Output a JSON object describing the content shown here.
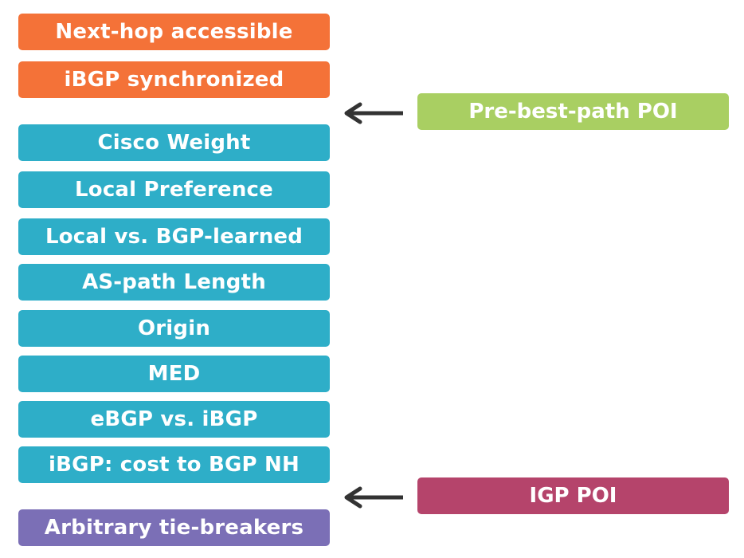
{
  "steps": [
    {
      "label": "Next-hop accessible",
      "category": "pre-check",
      "color": "#f47238"
    },
    {
      "label": "iBGP synchronized",
      "category": "pre-check",
      "color": "#f47238"
    },
    {
      "label": "Cisco Weight",
      "category": "best-path",
      "color": "#2eaec8"
    },
    {
      "label": "Local Preference",
      "category": "best-path",
      "color": "#2eaec8"
    },
    {
      "label": "Local vs. BGP-learned",
      "category": "best-path",
      "color": "#2eaec8"
    },
    {
      "label": "AS-path Length",
      "category": "best-path",
      "color": "#2eaec8"
    },
    {
      "label": "Origin",
      "category": "best-path",
      "color": "#2eaec8"
    },
    {
      "label": "MED",
      "category": "best-path",
      "color": "#2eaec8"
    },
    {
      "label": "eBGP vs. iBGP",
      "category": "best-path",
      "color": "#2eaec8"
    },
    {
      "label": "iBGP: cost to BGP NH",
      "category": "best-path",
      "color": "#2eaec8"
    },
    {
      "label": "Arbitrary tie-breakers",
      "category": "tie-breaker",
      "color": "#7b6fb6"
    }
  ],
  "annotations": [
    {
      "label": "Pre-best-path POI",
      "points_to": "between iBGP synchronized and Cisco Weight",
      "color": "#a9cf62"
    },
    {
      "label": "IGP POI",
      "points_to": "between iBGP: cost to BGP NH and Arbitrary tie-breakers",
      "color": "#b5446b"
    }
  ],
  "arrow_color": "#333333"
}
